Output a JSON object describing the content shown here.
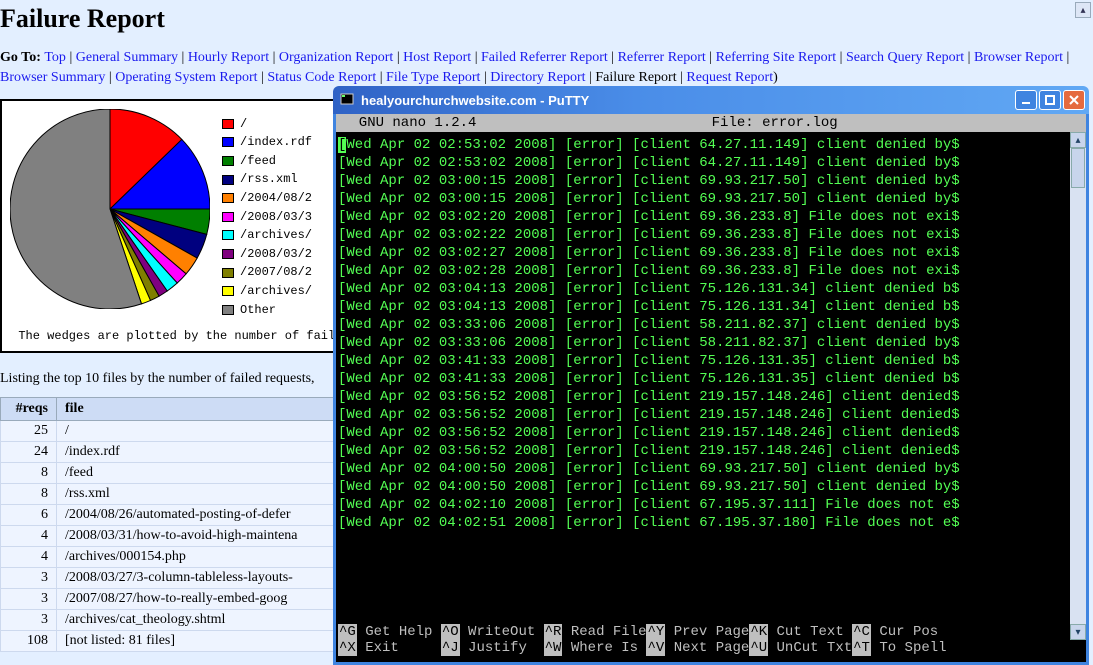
{
  "report": {
    "title": "Failure Report",
    "goto_prefix": "Go To: ",
    "links": [
      "Top",
      "General Summary",
      "Hourly Report",
      "Organization Report",
      "Host Report",
      "Failed Referrer Report",
      "Referrer Report",
      "Referring Site Report",
      "Search Query Report",
      "Browser Report",
      "Browser Summary",
      "Operating System Report",
      "Status Code Report",
      "File Type Report",
      "Directory Report"
    ],
    "current": "Failure Report",
    "links_after": [
      "Request Report"
    ],
    "caption": "The wedges are plotted by the number of failed requests.",
    "listing_intro": "Listing the top 10 files by the number of failed requests,"
  },
  "chart_data": {
    "type": "pie",
    "title": "",
    "series": [
      {
        "name": "/",
        "value": 25,
        "color": "#ff0000"
      },
      {
        "name": "/index.rdf",
        "value": 24,
        "color": "#0000ff"
      },
      {
        "name": "/feed",
        "value": 8,
        "color": "#007f00"
      },
      {
        "name": "/rss.xml",
        "value": 8,
        "color": "#00007f"
      },
      {
        "name": "/2004/08/2",
        "value": 6,
        "color": "#ff8000"
      },
      {
        "name": "/2008/03/3",
        "value": 4,
        "color": "#ff00ff"
      },
      {
        "name": "/archives/",
        "value": 4,
        "color": "#00ffff"
      },
      {
        "name": "/2008/03/2",
        "value": 3,
        "color": "#7f007f"
      },
      {
        "name": "/2007/08/2",
        "value": 3,
        "color": "#7f7f00"
      },
      {
        "name": "/archives/",
        "value": 3,
        "color": "#ffff00"
      },
      {
        "name": "Other",
        "value": 108,
        "color": "#808080"
      }
    ]
  },
  "table": {
    "headers": [
      "#reqs",
      "file"
    ],
    "rows": [
      {
        "reqs": 25,
        "file": "/"
      },
      {
        "reqs": 24,
        "file": "/index.rdf"
      },
      {
        "reqs": 8,
        "file": "/feed"
      },
      {
        "reqs": 8,
        "file": "/rss.xml"
      },
      {
        "reqs": 6,
        "file": "/2004/08/26/automated-posting-of-defer"
      },
      {
        "reqs": 4,
        "file": "/2008/03/31/how-to-avoid-high-maintena"
      },
      {
        "reqs": 4,
        "file": "/archives/000154.php"
      },
      {
        "reqs": 3,
        "file": "/2008/03/27/3-column-tableless-layouts-"
      },
      {
        "reqs": 3,
        "file": "/2007/08/27/how-to-really-embed-goog"
      },
      {
        "reqs": 3,
        "file": "/archives/cat_theology.shtml"
      }
    ],
    "footer_reqs": 108,
    "footer_file": "[not listed: 81 files]"
  },
  "putty": {
    "window_title": "healyourchurchwebsite.com - PuTTY",
    "nano_left": "  GNU nano 1.2.4",
    "nano_right": "File: error.log",
    "log_lines": [
      "[Wed Apr 02 02:53:02 2008] [error] [client 64.27.11.149] client denied by$",
      "[Wed Apr 02 02:53:02 2008] [error] [client 64.27.11.149] client denied by$",
      "[Wed Apr 02 03:00:15 2008] [error] [client 69.93.217.50] client denied by$",
      "[Wed Apr 02 03:00:15 2008] [error] [client 69.93.217.50] client denied by$",
      "[Wed Apr 02 03:02:20 2008] [error] [client 69.36.233.8] File does not exi$",
      "[Wed Apr 02 03:02:22 2008] [error] [client 69.36.233.8] File does not exi$",
      "[Wed Apr 02 03:02:27 2008] [error] [client 69.36.233.8] File does not exi$",
      "[Wed Apr 02 03:02:28 2008] [error] [client 69.36.233.8] File does not exi$",
      "[Wed Apr 02 03:04:13 2008] [error] [client 75.126.131.34] client denied b$",
      "[Wed Apr 02 03:04:13 2008] [error] [client 75.126.131.34] client denied b$",
      "[Wed Apr 02 03:33:06 2008] [error] [client 58.211.82.37] client denied by$",
      "[Wed Apr 02 03:33:06 2008] [error] [client 58.211.82.37] client denied by$",
      "[Wed Apr 02 03:41:33 2008] [error] [client 75.126.131.35] client denied b$",
      "[Wed Apr 02 03:41:33 2008] [error] [client 75.126.131.35] client denied b$",
      "[Wed Apr 02 03:56:52 2008] [error] [client 219.157.148.246] client denied$",
      "[Wed Apr 02 03:56:52 2008] [error] [client 219.157.148.246] client denied$",
      "[Wed Apr 02 03:56:52 2008] [error] [client 219.157.148.246] client denied$",
      "[Wed Apr 02 03:56:52 2008] [error] [client 219.157.148.246] client denied$",
      "[Wed Apr 02 04:00:50 2008] [error] [client 69.93.217.50] client denied by$",
      "[Wed Apr 02 04:00:50 2008] [error] [client 69.93.217.50] client denied by$",
      "[Wed Apr 02 04:02:10 2008] [error] [client 67.195.37.111] File does not e$",
      "[Wed Apr 02 04:02:51 2008] [error] [client 67.195.37.180] File does not e$"
    ],
    "nano_footer": [
      {
        "k": "^G",
        "l": "Get Help"
      },
      {
        "k": "^O",
        "l": "WriteOut"
      },
      {
        "k": "^R",
        "l": "Read File"
      },
      {
        "k": "^Y",
        "l": "Prev Page"
      },
      {
        "k": "^K",
        "l": "Cut Text"
      },
      {
        "k": "^C",
        "l": "Cur Pos"
      },
      {
        "k": "^X",
        "l": "Exit"
      },
      {
        "k": "^J",
        "l": "Justify"
      },
      {
        "k": "^W",
        "l": "Where Is"
      },
      {
        "k": "^V",
        "l": "Next Page"
      },
      {
        "k": "^U",
        "l": "UnCut Txt"
      },
      {
        "k": "^T",
        "l": "To Spell"
      }
    ]
  }
}
